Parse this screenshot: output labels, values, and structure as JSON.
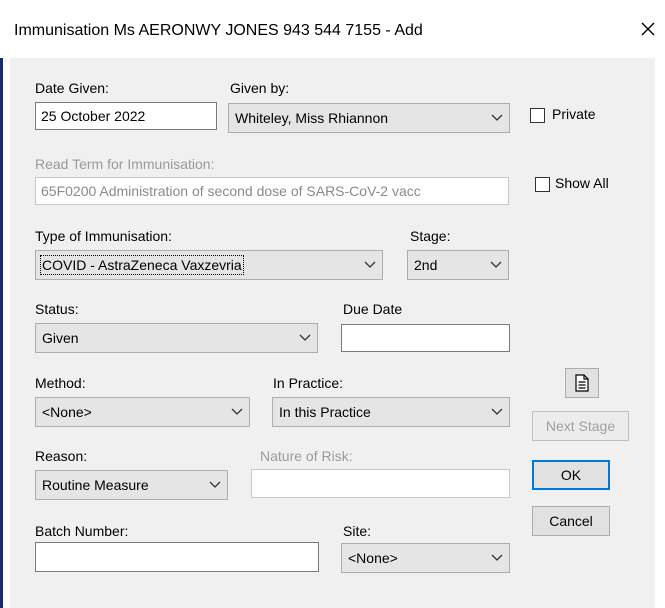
{
  "window": {
    "title": "Immunisation Ms AERONWY JONES 943 544 7155 - Add",
    "close_glyph": "✕"
  },
  "date_given": {
    "label": "Date Given:",
    "value": "25 October 2022"
  },
  "given_by": {
    "label": "Given by:",
    "value": "Whiteley, Miss Rhiannon"
  },
  "private": {
    "label": "Private",
    "checked": false
  },
  "read_term": {
    "label": "Read Term for Immunisation:",
    "value": "65F0200 Administration of second dose of SARS-CoV-2 vacc"
  },
  "show_all": {
    "label": "Show All",
    "checked": false
  },
  "type_of_immunisation": {
    "label": "Type of Immunisation:",
    "value": "COVID - AstraZeneca Vaxzevria"
  },
  "stage": {
    "label": "Stage:",
    "value": "2nd"
  },
  "status": {
    "label": "Status:",
    "value": "Given"
  },
  "due_date": {
    "label": "Due Date",
    "value": ""
  },
  "method": {
    "label": "Method:",
    "value": "<None>"
  },
  "in_practice": {
    "label": "In Practice:",
    "value": "In this Practice"
  },
  "reason": {
    "label": "Reason:",
    "value": "Routine Measure"
  },
  "nature_of_risk": {
    "label": "Nature of Risk:",
    "value": ""
  },
  "batch_number": {
    "label": "Batch Number:",
    "value": ""
  },
  "site": {
    "label": "Site:",
    "value": "<None>"
  },
  "buttons": {
    "document_icon": "document-icon",
    "next_stage": "Next Stage",
    "ok": "OK",
    "cancel": "Cancel"
  },
  "colors": {
    "default_button_border": "#0078d7",
    "window_accent": "#1a2a6e"
  }
}
